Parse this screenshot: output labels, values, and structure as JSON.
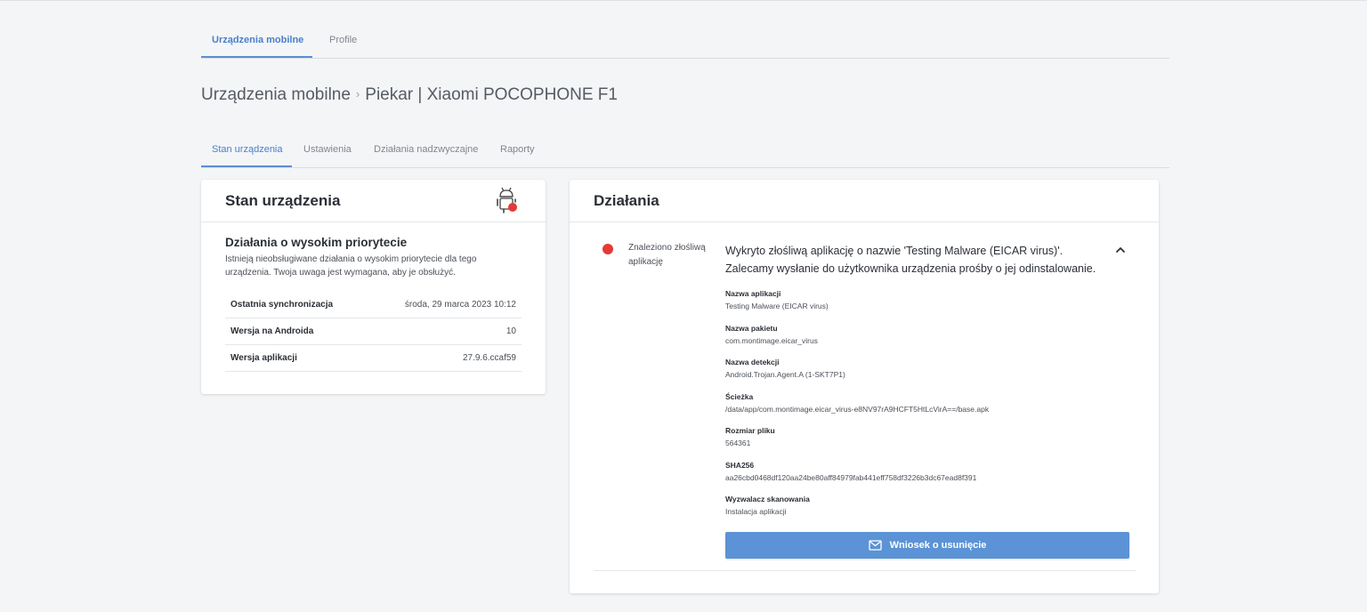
{
  "top_tabs": [
    {
      "label": "Urządzenia mobilne",
      "active": true
    },
    {
      "label": "Profile",
      "active": false
    }
  ],
  "breadcrumb": {
    "root": "Urządzenia mobilne",
    "separator": "›",
    "device": "Piekar | Xiaomi POCOPHONE F1"
  },
  "sub_tabs": [
    {
      "label": "Stan urządzenia",
      "active": true
    },
    {
      "label": "Ustawienia",
      "active": false
    },
    {
      "label": "Działania nadzwyczajne",
      "active": false
    },
    {
      "label": "Raporty",
      "active": false
    }
  ],
  "device_state": {
    "title": "Stan urządzenia",
    "icon": "android-alert-icon",
    "priority_title": "Działania o wysokim priorytecie",
    "priority_desc": "Istnieją nieobsługiwane działania o wysokim priorytecie dla tego urządzenia. Twoja uwaga jest wymagana, aby je obsłużyć.",
    "rows": [
      {
        "key": "Ostatnia synchronizacja",
        "value": "środa, 29 marca 2023 10:12"
      },
      {
        "key": "Wersja na Androida",
        "value": "10"
      },
      {
        "key": "Wersja aplikacji",
        "value": "27.9.6.ccaf59"
      }
    ]
  },
  "actions": {
    "title": "Działania",
    "alert_label": "Znaleziono złośliwą aplikację",
    "alert_desc": "Wykryto złośliwą aplikację o nazwie 'Testing Malware (EICAR virus)'. Zalecamy wysłanie do użytkownika urządzenia prośby o jej odinstalowanie.",
    "details": [
      {
        "key": "Nazwa aplikacji",
        "value": "Testing Malware (EICAR virus)"
      },
      {
        "key": "Nazwa pakietu",
        "value": "com.montimage.eicar_virus"
      },
      {
        "key": "Nazwa detekcji",
        "value": "Android.Trojan.Agent.A (1-SKT7P1)"
      },
      {
        "key": "Ścieżka",
        "value": "/data/app/com.montimage.eicar_virus-e8NV97rA9HCFT5HtLcVirA==/base.apk"
      },
      {
        "key": "Rozmiar pliku",
        "value": "564361"
      },
      {
        "key": "SHA256",
        "value": "aa26cbd0468df120aa24be80aff84979fab441eff758df3226b3dc67ead8f391"
      },
      {
        "key": "Wyzwalacz skanowania",
        "value": "Instalacja aplikacji"
      }
    ],
    "button_label": "Wniosek o usunięcie"
  },
  "colors": {
    "accent": "#5b8fd3",
    "button": "#5b93d6",
    "alert": "#e53935",
    "background": "#f4f5f7"
  }
}
